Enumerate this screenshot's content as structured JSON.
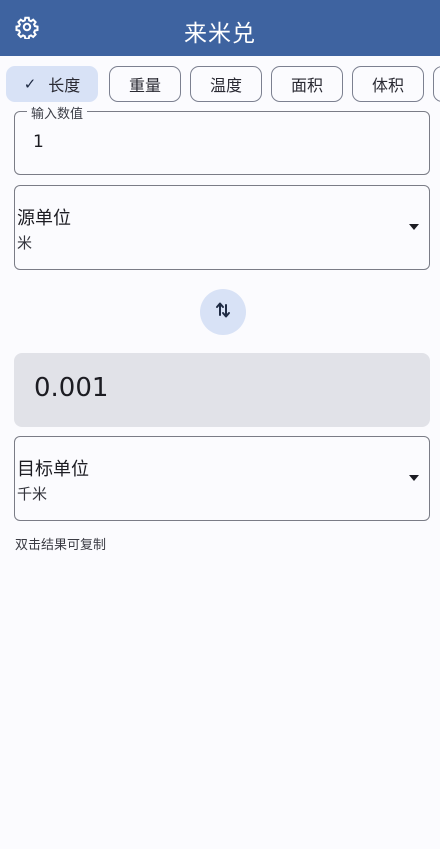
{
  "appbar": {
    "title": "来米兑",
    "settings_icon": "gear-icon"
  },
  "categories": [
    {
      "label": "长度",
      "selected": true
    },
    {
      "label": "重量",
      "selected": false
    },
    {
      "label": "温度",
      "selected": false
    },
    {
      "label": "面积",
      "selected": false
    },
    {
      "label": "体积",
      "selected": false
    }
  ],
  "input": {
    "legend": "输入数值",
    "value": "1"
  },
  "source_unit": {
    "label": "源单位",
    "value": "米"
  },
  "swap": {
    "icon": "swap-vertical-icon"
  },
  "result": {
    "value": "0.001"
  },
  "target_unit": {
    "label": "目标单位",
    "value": "千米"
  },
  "hint": "双击结果可复制",
  "colors": {
    "appbar": "#3e63a0",
    "chip_selected": "#d8e2f6",
    "result_bg": "#e1e2e8",
    "background": "#fbfbfe"
  }
}
